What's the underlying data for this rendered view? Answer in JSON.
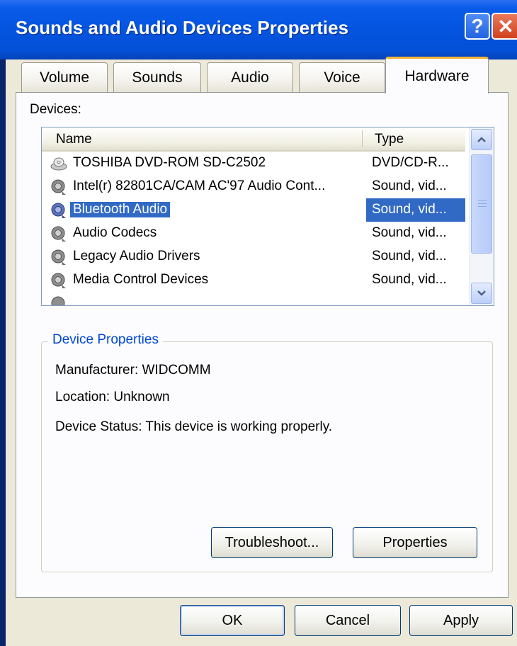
{
  "window": {
    "title": "Sounds and Audio Devices Properties"
  },
  "titlebar": {
    "help_glyph": "?",
    "close_glyph": "✕"
  },
  "tabs": [
    {
      "label": "Volume"
    },
    {
      "label": "Sounds"
    },
    {
      "label": "Audio"
    },
    {
      "label": "Voice"
    },
    {
      "label": "Hardware",
      "active": true
    }
  ],
  "devices": {
    "label": "Devices:",
    "columns": {
      "name": "Name",
      "type": "Type"
    },
    "rows": [
      {
        "name": "TOSHIBA DVD-ROM SD-C2502",
        "type": "DVD/CD-R...",
        "icon": "cd-drive-icon"
      },
      {
        "name": "Intel(r) 82801CA/CAM AC'97 Audio Cont...",
        "type": "Sound, vid...",
        "icon": "speaker-icon"
      },
      {
        "name": "Bluetooth Audio",
        "type": "Sound, vid...",
        "icon": "speaker-icon",
        "selected": true
      },
      {
        "name": "Audio Codecs",
        "type": "Sound, vid...",
        "icon": "speaker-icon"
      },
      {
        "name": "Legacy Audio Drivers",
        "type": "Sound, vid...",
        "icon": "speaker-icon"
      },
      {
        "name": "Media Control Devices",
        "type": "Sound, vid...",
        "icon": "speaker-icon"
      }
    ]
  },
  "device_properties": {
    "title": "Device Properties",
    "manufacturer": "Manufacturer: WIDCOMM",
    "location": "Location: Unknown",
    "status": "Device Status: This device is working properly."
  },
  "buttons": {
    "troubleshoot": "Troubleshoot...",
    "properties": "Properties",
    "ok": "OK",
    "cancel": "Cancel",
    "apply": "Apply"
  },
  "colors": {
    "titlebar": "#0454e0",
    "selection": "#316ac5",
    "tab_highlight": "#f8b33c",
    "group_title": "#0046d5"
  }
}
